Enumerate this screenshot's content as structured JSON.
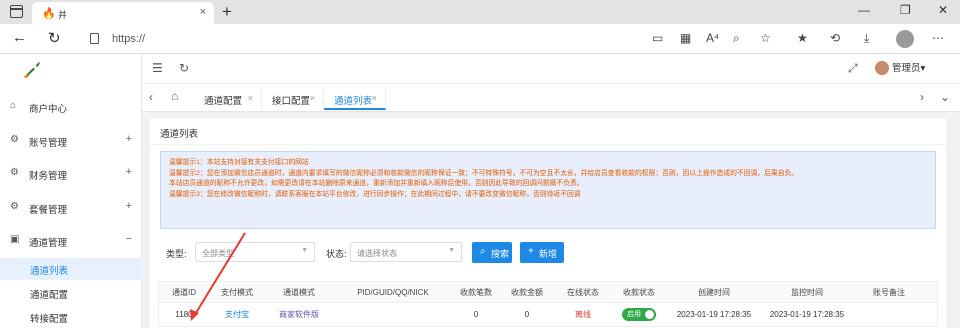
{
  "browser": {
    "tab_title": "并",
    "tab_close": "×",
    "new_tab": "+",
    "url": "https://",
    "window_controls": [
      "—",
      "❐",
      "✕"
    ]
  },
  "app": {
    "admin_label": "管理员",
    "admin_caret": "▾"
  },
  "sidebar": {
    "items": [
      {
        "label": "商户中心",
        "icon": "user-icon",
        "toggle": ""
      },
      {
        "label": "账号管理",
        "icon": "gear-icon",
        "toggle": "+"
      },
      {
        "label": "财务管理",
        "icon": "gear-icon",
        "toggle": "+"
      },
      {
        "label": "套餐管理",
        "icon": "gear-icon",
        "toggle": "+"
      },
      {
        "label": "通道管理",
        "icon": "grid-icon",
        "toggle": "−"
      }
    ],
    "subitems": [
      {
        "label": "通道列表",
        "active": true
      },
      {
        "label": "通道配置",
        "active": false
      },
      {
        "label": "转接配置",
        "active": false
      }
    ]
  },
  "page_tabs": [
    {
      "label": "通道配置",
      "close": "×",
      "active": false
    },
    {
      "label": "接口配置",
      "close": "×",
      "active": false
    },
    {
      "label": "通道列表",
      "close": "×",
      "active": true
    }
  ],
  "card": {
    "title": "通道列表",
    "notices": [
      "温馨提示1：本站支持对接有关支付接口的网站",
      "温馨提示2：您在添加微信店员通道时，通道内要求填写的微信昵称必须和收款微信的昵称保证一致；不可特殊符号，不可为空且不太长，并给店员查看收款的权限；否则，因以上操作造成的不回调，后果自负。",
      "本站店员通道的昵称不允许更改，如需更改请在本站删除原来通道，重新添加并重新填入昵称后使用，否则因此导致的回调问题概不负责。",
      "温馨提示3：您在修改微信昵称时，请联系客服在本站平台修改，进行同步操作；在此期间过程中，请不要改变微信昵称，否则待返不回调"
    ],
    "filter_type_label": "类型:",
    "filter_type_value": "全部类型",
    "filter_status_label": "状态:",
    "filter_status_value": "请选择状态",
    "search_label": "搜索",
    "add_label": "新增"
  },
  "table": {
    "headers": [
      "通道ID",
      "支付模式",
      "通道模式",
      "PID/GUID/QQ/NICK",
      "收款笔数",
      "收款金额",
      "在线状态",
      "收款状态",
      "创建时间",
      "监控时间",
      "账号备注"
    ],
    "rows": [
      {
        "id": "1180",
        "pay_mode": "支付宝",
        "channel_mode": "商家软件版",
        "pid": "",
        "count": "0",
        "amount": "0",
        "online": "离线",
        "toggle_label": "启用",
        "toggle_on": true,
        "created": "2023-01-19 17:28:35",
        "monitored": "2023-01-19 17:28:35",
        "remark": ""
      }
    ]
  },
  "colors": {
    "accent": "#1e88e5",
    "notice_text": "#e45a00",
    "offline": "#e53935",
    "toggle_on": "#2eaa4a",
    "annotation": "#e53935"
  }
}
